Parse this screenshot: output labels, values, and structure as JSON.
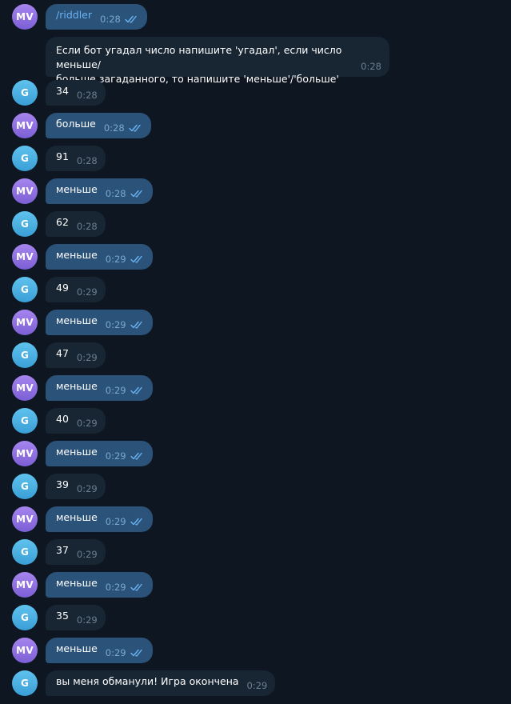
{
  "colors": {
    "background": "#0e1621",
    "outgoing_bubble": "#2b5278",
    "incoming_bubble": "#182533",
    "outgoing_time": "#7da8d3",
    "incoming_time": "#6d7f8f",
    "read_check": "#6ab3f3",
    "avatar_mv": "#8f6fe2",
    "avatar_g": "#4cb1e2"
  },
  "messages": [
    {
      "sender": "MV",
      "text": "/riddler",
      "time": "0:28",
      "read": true
    },
    {
      "sender": "G",
      "lines": [
        "Если бот угадал число напишите 'угадал', если число меньше/",
        "больше загаданного, то напишите 'меньше'/'больше'"
      ],
      "time": "0:28"
    },
    {
      "sender": "G",
      "text": "34",
      "time": "0:28"
    },
    {
      "sender": "MV",
      "text": "больше",
      "time": "0:28",
      "read": true
    },
    {
      "sender": "G",
      "text": "91",
      "time": "0:28"
    },
    {
      "sender": "MV",
      "text": "меньше",
      "time": "0:28",
      "read": true
    },
    {
      "sender": "G",
      "text": "62",
      "time": "0:28"
    },
    {
      "sender": "MV",
      "text": "меньше",
      "time": "0:29",
      "read": true
    },
    {
      "sender": "G",
      "text": "49",
      "time": "0:29"
    },
    {
      "sender": "MV",
      "text": "меньше",
      "time": "0:29",
      "read": true
    },
    {
      "sender": "G",
      "text": "47",
      "time": "0:29"
    },
    {
      "sender": "MV",
      "text": "меньше",
      "time": "0:29",
      "read": true
    },
    {
      "sender": "G",
      "text": "40",
      "time": "0:29"
    },
    {
      "sender": "MV",
      "text": "меньше",
      "time": "0:29",
      "read": true
    },
    {
      "sender": "G",
      "text": "39",
      "time": "0:29"
    },
    {
      "sender": "MV",
      "text": "меньше",
      "time": "0:29",
      "read": true
    },
    {
      "sender": "G",
      "text": "37",
      "time": "0:29"
    },
    {
      "sender": "MV",
      "text": "меньше",
      "time": "0:29",
      "read": true
    },
    {
      "sender": "G",
      "text": "35",
      "time": "0:29"
    },
    {
      "sender": "MV",
      "text": "меньше",
      "time": "0:29",
      "read": true
    },
    {
      "sender": "G",
      "text": "вы меня обманули! Игра окончена",
      "time": "0:29"
    }
  ]
}
